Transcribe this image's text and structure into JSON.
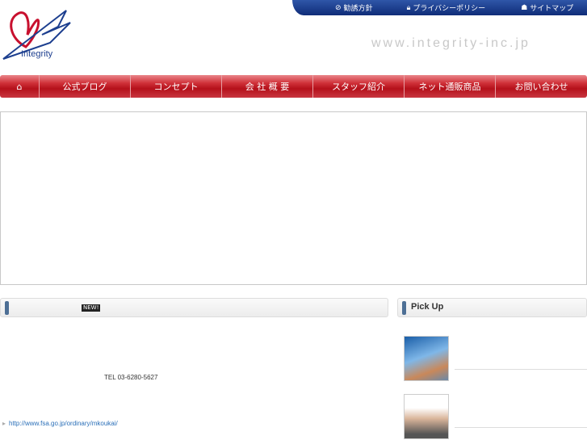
{
  "logo": {
    "text": "Integrity"
  },
  "topbar": {
    "links": [
      {
        "icon": "no-entry-icon",
        "label": "勧誘方針"
      },
      {
        "icon": "lock-icon",
        "label": "プライバシーポリシー"
      },
      {
        "icon": "sitemap-icon",
        "label": "サイトマップ"
      }
    ]
  },
  "domain": "www.integrity-inc.jp",
  "nav": {
    "home_icon": "home-icon",
    "items": [
      "公式ブログ",
      "コンセプト",
      "会 社 概 要",
      "スタッフ紹介",
      "ネット通販商品",
      "お問い合わせ"
    ]
  },
  "news": {
    "badge": "NEW!",
    "tel": "TEL 03-6280-5627",
    "link": "http://www.fsa.go.jp/ordinary/mkoukai/"
  },
  "pickup": {
    "title": "Pick Up"
  },
  "colors": {
    "nav": "#c0141e",
    "topbar": "#1a3a8a",
    "link": "#2a6fb8"
  }
}
